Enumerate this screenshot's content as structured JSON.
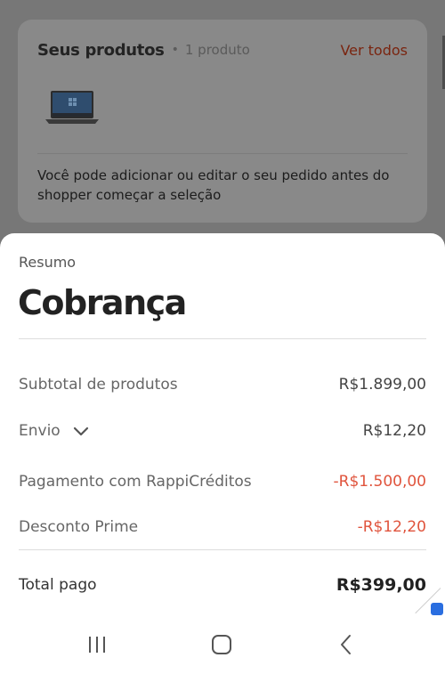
{
  "products_card": {
    "title": "Seus produtos",
    "separator": "•",
    "count": "1 produto",
    "see_all": "Ver todos",
    "items": [
      {
        "icon": "laptop-icon"
      }
    ],
    "note": "Você pode adicionar ou editar o seu pedido antes do shopper começar a seleção"
  },
  "summary": {
    "subtitle": "Resumo",
    "title": "Cobrança",
    "rows": [
      {
        "label": "Subtotal de produtos",
        "amount": "R$1.899,00"
      },
      {
        "label": "Envio",
        "amount": "R$12,20",
        "expandable": true
      },
      {
        "label": "Pagamento com RappiCréditos",
        "amount": "-R$1.500,00",
        "negative": true
      },
      {
        "label": "Desconto Prime",
        "amount": "-R$12,20",
        "negative": true
      }
    ],
    "total": {
      "label": "Total pago",
      "amount": "R$399,00"
    }
  },
  "colors": {
    "accent": "#e0543d",
    "see_all_dimmed": "#7a2510",
    "title": "#222222"
  },
  "navbar": {
    "icons": [
      "recent-apps-icon",
      "home-icon",
      "back-icon"
    ]
  }
}
